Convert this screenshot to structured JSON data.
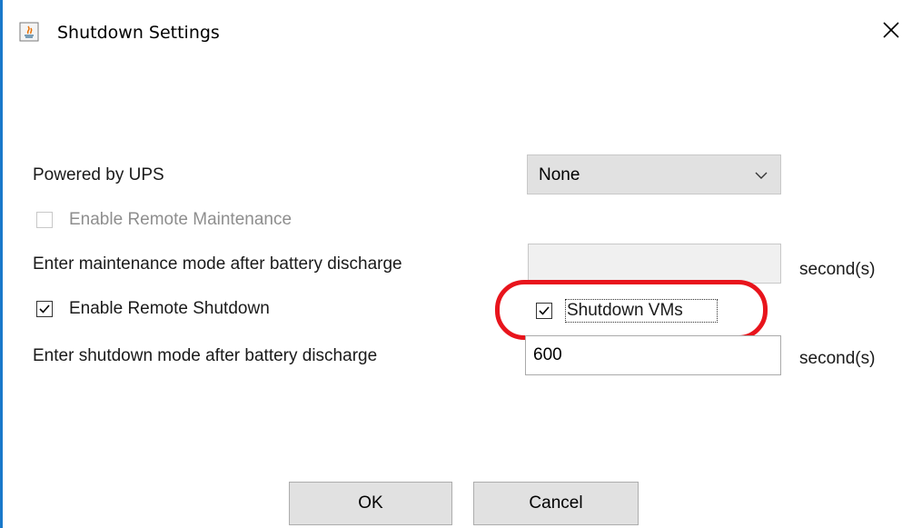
{
  "window": {
    "title": "Shutdown Settings",
    "icon": "java-app-icon",
    "close_icon": "close-icon"
  },
  "ups": {
    "label": "Powered by UPS",
    "selected": "None"
  },
  "remote_maintenance": {
    "label": "Enable Remote Maintenance",
    "checked": false,
    "enabled": false
  },
  "maintenance_delay": {
    "label": "Enter maintenance mode after battery discharge",
    "value": "",
    "unit": "second(s)"
  },
  "remote_shutdown": {
    "label": "Enable Remote Shutdown",
    "checked": true
  },
  "shutdown_vms": {
    "label": "Shutdown VMs",
    "checked": true
  },
  "shutdown_delay": {
    "label": "Enter shutdown mode after battery discharge",
    "value": "600",
    "unit": "second(s)"
  },
  "buttons": {
    "ok": "OK",
    "cancel": "Cancel"
  },
  "colors": {
    "highlight": "#e8141c",
    "window_border": "#1979ca"
  }
}
